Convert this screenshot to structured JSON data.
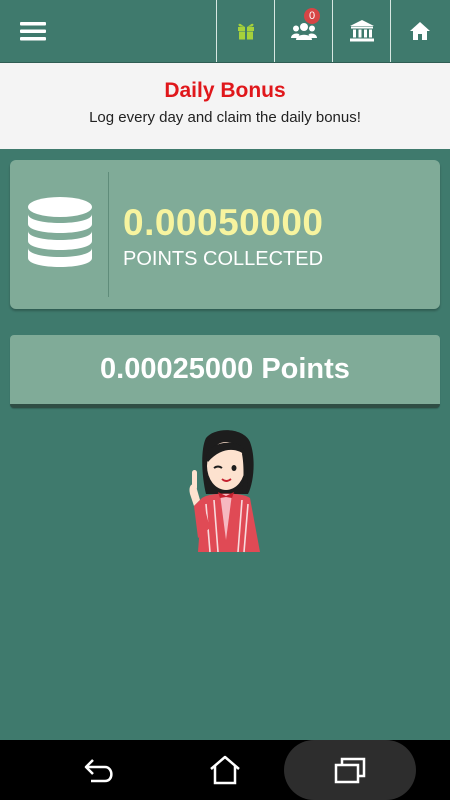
{
  "toolbar": {
    "menu_icon": "hamburger-menu-icon",
    "gift_icon": "gift-icon",
    "users_icon": "users-group-icon",
    "users_badge": "0",
    "bank_icon": "bank-icon",
    "home_icon": "home-icon"
  },
  "banner": {
    "title": "Daily Bonus",
    "subtitle": "Log every day and claim the daily bonus!"
  },
  "points_card": {
    "icon": "coin-stack-icon",
    "value": "0.00050000",
    "label": "POINTS COLLECTED"
  },
  "claim_button": {
    "label": "0.00025000 Points"
  },
  "colors": {
    "background": "#3f7a6d",
    "card": "#80ab98",
    "title_red": "#e0171b",
    "value_yellow": "#f7f49f",
    "gift_green": "#a5d13b"
  },
  "nav": {
    "back_icon": "back-icon",
    "home_icon": "home-outline-icon",
    "recents_icon": "recent-apps-icon"
  }
}
